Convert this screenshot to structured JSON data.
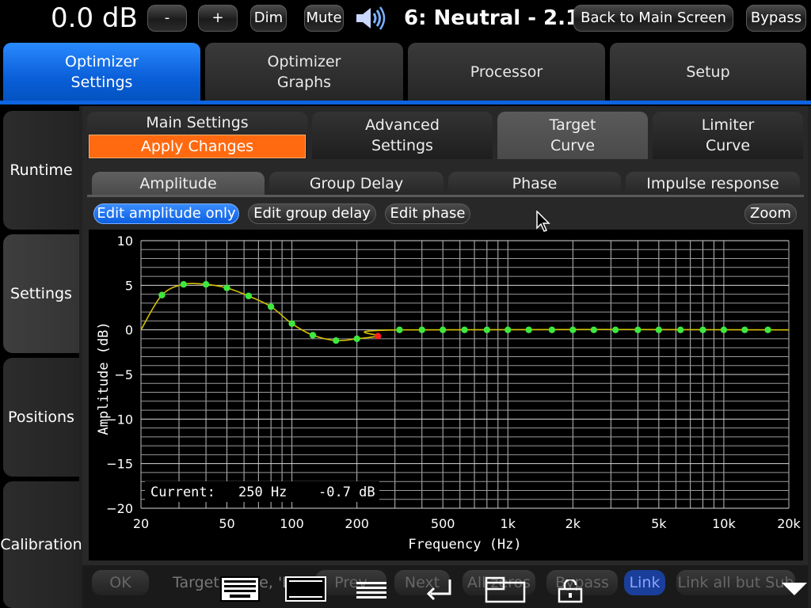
{
  "topbar": {
    "volume": "0.0 dB",
    "minus": "-",
    "plus": "+",
    "dim": "Dim",
    "mute": "Mute",
    "preset": "6: Neutral - 2.1",
    "back": "Back to Main Screen",
    "bypass": "Bypass"
  },
  "main_tabs": [
    {
      "label": "Optimizer\nSettings",
      "active": true
    },
    {
      "label": "Optimizer\nGraphs",
      "active": false
    },
    {
      "label": "Processor",
      "active": false
    },
    {
      "label": "Setup",
      "active": false
    }
  ],
  "sidebar": [
    {
      "label": "Runtime"
    },
    {
      "label": "Settings",
      "active": true
    },
    {
      "label": "Positions"
    },
    {
      "label": "Calibration"
    }
  ],
  "sub_tabs": {
    "main_settings": "Main Settings",
    "apply_changes": "Apply Changes",
    "advanced": "Advanced\nSettings",
    "target": "Target\nCurve",
    "limiter": "Limiter\nCurve"
  },
  "graph_tabs": [
    "Amplitude",
    "Group Delay",
    "Phase",
    "Impulse response"
  ],
  "edit_buttons": {
    "amplitude": "Edit amplitude only",
    "group_delay": "Edit group delay",
    "phase": "Edit phase",
    "zoom": "Zoom"
  },
  "readout": {
    "label": "Current:",
    "freq": "250 Hz",
    "value": "-0.7 dB"
  },
  "chart_data": {
    "type": "line",
    "xlabel": "Frequency (Hz)",
    "ylabel": "Amplitude (dB)",
    "xscale": "log",
    "xlim": [
      20,
      20000
    ],
    "ylim": [
      -20,
      10
    ],
    "xticks": [
      20,
      50,
      100,
      200,
      500,
      1000,
      2000,
      5000,
      10000,
      20000
    ],
    "xticklabels": [
      "20",
      "50",
      "100",
      "200",
      "500",
      "1k",
      "2k",
      "5k",
      "10k",
      "20k"
    ],
    "yticks": [
      10,
      5,
      0,
      -5,
      -10,
      -15,
      -20
    ],
    "yticklabels": [
      "10",
      "5",
      "0",
      "−5",
      "−10",
      "−15",
      "−20"
    ],
    "grid": true,
    "line_color": "#d4c000",
    "point_color": "#3fe83f",
    "selected_color": "#ff2020",
    "curve": [
      [
        20,
        0
      ],
      [
        25,
        3.9
      ],
      [
        31.5,
        5.1
      ],
      [
        40,
        5.1
      ],
      [
        50,
        4.7
      ],
      [
        63,
        3.8
      ],
      [
        80,
        2.6
      ],
      [
        100,
        0.7
      ],
      [
        125,
        -0.6
      ],
      [
        160,
        -1.2
      ],
      [
        200,
        -1.0
      ],
      [
        250,
        -0.7
      ],
      [
        315,
        0
      ],
      [
        20000,
        0
      ]
    ],
    "points": [
      {
        "x": 25,
        "y": 3.9
      },
      {
        "x": 31.5,
        "y": 5.1
      },
      {
        "x": 40,
        "y": 5.1
      },
      {
        "x": 50,
        "y": 4.7
      },
      {
        "x": 63,
        "y": 3.8
      },
      {
        "x": 80,
        "y": 2.6
      },
      {
        "x": 100,
        "y": 0.7
      },
      {
        "x": 125,
        "y": -0.6
      },
      {
        "x": 160,
        "y": -1.2
      },
      {
        "x": 200,
        "y": -1.0
      },
      {
        "x": 250,
        "y": -0.7,
        "selected": true
      },
      {
        "x": 315,
        "y": 0
      },
      {
        "x": 400,
        "y": 0
      },
      {
        "x": 500,
        "y": 0
      },
      {
        "x": 630,
        "y": 0
      },
      {
        "x": 800,
        "y": 0
      },
      {
        "x": 1000,
        "y": 0
      },
      {
        "x": 1250,
        "y": 0
      },
      {
        "x": 1600,
        "y": 0
      },
      {
        "x": 2000,
        "y": 0
      },
      {
        "x": 2500,
        "y": 0
      },
      {
        "x": 3150,
        "y": 0
      },
      {
        "x": 4000,
        "y": 0
      },
      {
        "x": 5000,
        "y": 0
      },
      {
        "x": 6300,
        "y": 0
      },
      {
        "x": 8000,
        "y": 0
      },
      {
        "x": 10000,
        "y": 0
      },
      {
        "x": 12500,
        "y": 0
      },
      {
        "x": 16000,
        "y": 0
      }
    ]
  },
  "bottom": {
    "ok": "OK",
    "target_text": "Target Curve, 'L",
    "prev": "Prev",
    "next": "Next",
    "all_zeros": "All zeros",
    "bypass": "Bypass",
    "link": "Link",
    "link_all": "Link all but Sub"
  }
}
